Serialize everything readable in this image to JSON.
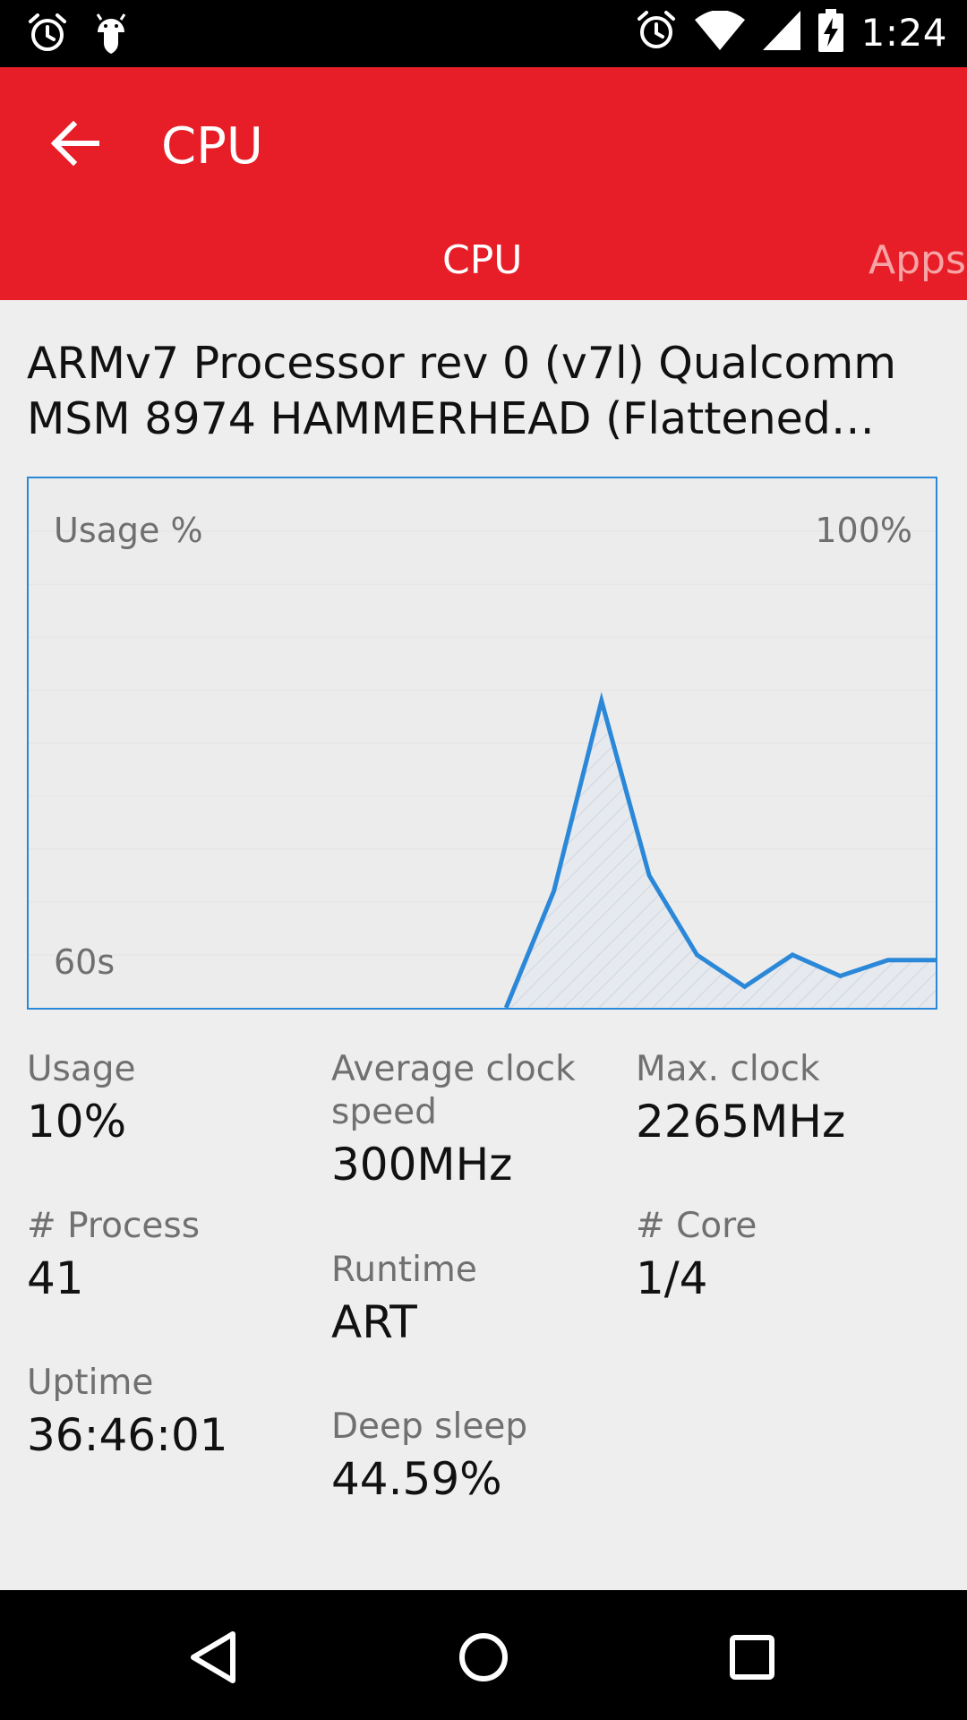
{
  "status_bar": {
    "time": "1:24",
    "left_icons": [
      "alarm-icon",
      "android-debug-icon"
    ],
    "right_icons": [
      "alarm-icon",
      "wifi-icon",
      "cell-signal-icon",
      "battery-charging-icon"
    ]
  },
  "app_bar": {
    "title": "CPU",
    "tabs": [
      {
        "label": "CPU",
        "selected": true
      },
      {
        "label": "Apps",
        "selected": false
      }
    ],
    "accent_color": "#e71e27"
  },
  "processor_name": "ARMv7 Processor rev 0 (v7l) Qualcomm MSM 8974 HAMMERHEAD (Flattened…",
  "chart_data": {
    "type": "area",
    "title": "Usage %",
    "max_label": "100%",
    "time_label": "60s",
    "ylim": [
      0,
      100
    ],
    "x": [
      0,
      1,
      2,
      3,
      4,
      5,
      6,
      7,
      8,
      9,
      10,
      11,
      12,
      13,
      14,
      15,
      16,
      17,
      18,
      19
    ],
    "values": [
      0,
      0,
      0,
      0,
      0,
      0,
      0,
      0,
      0,
      0,
      0,
      22,
      58,
      25,
      10,
      4,
      10,
      6,
      9,
      9
    ],
    "line_color": "#2b88d8"
  },
  "metrics": {
    "usage": {
      "label": "Usage",
      "value": "10%"
    },
    "avg_clock": {
      "label": "Average clock speed",
      "value": "300MHz"
    },
    "max_clock": {
      "label": "Max. clock",
      "value": "2265MHz"
    },
    "process": {
      "label": "# Process",
      "value": "41"
    },
    "runtime": {
      "label": "Runtime",
      "value": "ART"
    },
    "core": {
      "label": "# Core",
      "value": "1/4"
    },
    "uptime": {
      "label": "Uptime",
      "value": "36:46:01"
    },
    "deep_sleep": {
      "label": "Deep sleep",
      "value": "44.59%"
    }
  },
  "nav_bar": {
    "buttons": [
      "back-icon",
      "home-icon",
      "recents-icon"
    ]
  }
}
